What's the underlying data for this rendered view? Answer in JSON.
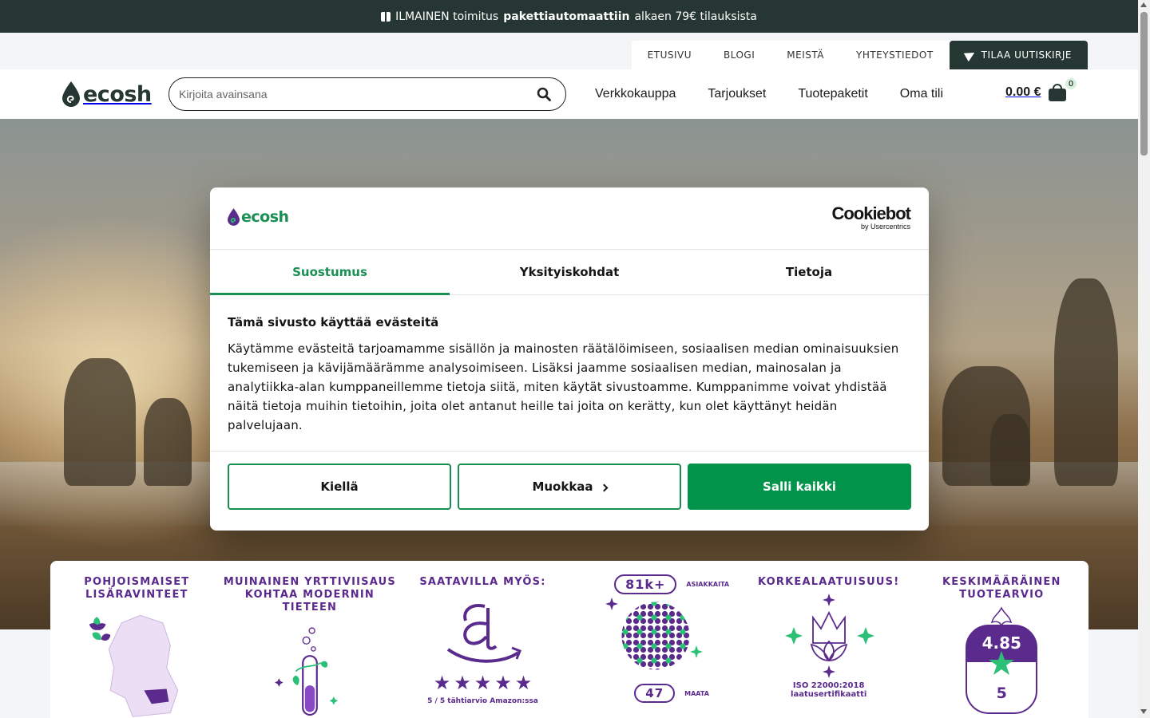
{
  "promo": {
    "icon": "gift-icon",
    "text_before": "ILMAINEN toimitus",
    "text_bold": "pakettiautomaattiin",
    "text_after": "alkaen 79€ tilauksista"
  },
  "top_links": {
    "items": [
      "ETUSIVU",
      "BLOGI",
      "MEISTÄ",
      "YHTEYSTIEDOT"
    ],
    "newsletter_label": "TILAA UUTISKIRJE"
  },
  "header": {
    "logo_text": "ecosh",
    "search_placeholder": "Kirjoita avainsana",
    "nav": [
      "Verkkokauppa",
      "Tarjoukset",
      "Tuotepaketit",
      "Oma tili"
    ],
    "cart_total": "0.00 €",
    "cart_count": "0"
  },
  "consent": {
    "logo_text": "ecosh",
    "provider_main": "Cookiebot",
    "provider_sub": "by Usercentrics",
    "tabs": [
      "Suostumus",
      "Yksityiskohdat",
      "Tietoja"
    ],
    "active_tab": "Suostumus",
    "heading": "Tämä sivusto käyttää evästeitä",
    "body": "Käytämme evästeitä tarjoamamme sisällön ja mainosten räätälöimiseen, sosiaalisen median ominaisuuksien tukemiseen ja kävijämäärämme analysoimiseen. Lisäksi jaamme sosiaalisen median, mainosalan ja analytiikka-alan kumppaneillemme tietoja siitä, miten käytät sivustoamme. Kumppanimme voivat yhdistää näitä tietoja muihin tietoihin, joita olet antanut heille tai joita on kerätty, kun olet käyttänyt heidän palvelujaan.",
    "deny_label": "Kiellä",
    "customize_label": "Muokkaa",
    "allow_label": "Salli kaikki",
    "accent_color": "#1a8f53"
  },
  "features": {
    "f1_title": "POHJOISMAISET\nLISÄRAVINTEET",
    "f2_title": "MUINAINEN YRTTIVIISAUS\nKOHTAA MODERNIN TIETEEN",
    "f3_title": "SAATAVILLA MYÖS:",
    "f3_caption": "5 / 5 tähtiarvio Amazon:ssa",
    "f4_customers": "81k+",
    "f4_customers_label": "ASIAKKAITA",
    "f4_countries": "47",
    "f4_countries_label": "MAATA",
    "f5_title": "KORKEALAATUISUUS!",
    "f5_caption_1": "ISO 22000:2018",
    "f5_caption_2": "laatusertifikaatti",
    "f6_title": "KESKIMÄÄRÄINEN\nTUOTEARVIO",
    "f6_rating": "4.85",
    "f6_max": "5",
    "brand_purple": "#5a2a8c",
    "brand_green": "#2bbf77"
  }
}
